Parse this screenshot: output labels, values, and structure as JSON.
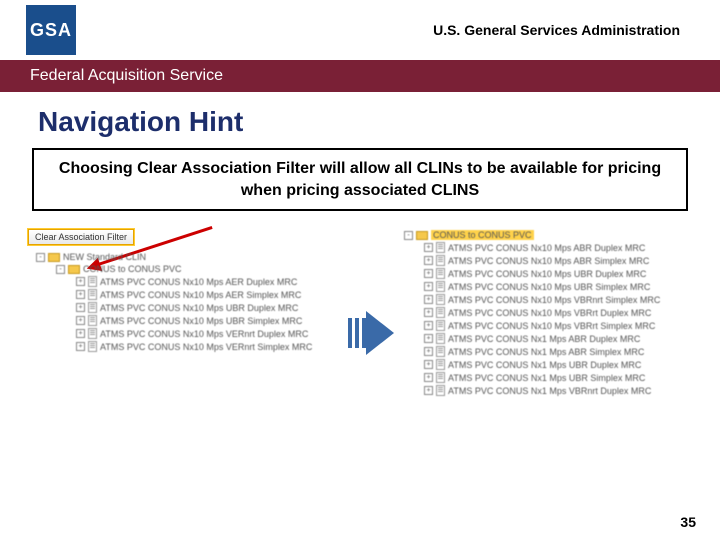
{
  "header": {
    "logo_text": "GSA",
    "org_title": "U.S. General Services Administration",
    "bar_text": "Federal Acquisition Service"
  },
  "title": "Navigation Hint",
  "callout": "Choosing Clear Association Filter will allow all CLINs to be available for pricing when pricing associated CLINS",
  "left": {
    "clear_btn": "Clear Association Filter",
    "root_folder": "NEW Standard CLIN",
    "sub_folder": "CONUS to CONUS PVC",
    "items": [
      "ATMS PVC CONUS Nx10 Mps AER Duplex MRC",
      "ATMS PVC CONUS Nx10 Mps AER Simplex MRC",
      "ATMS PVC CONUS Nx10 Mps UBR Duplex MRC",
      "ATMS PVC CONUS Nx10 Mps UBR Simplex MRC",
      "ATMS PVC CONUS Nx10 Mps VERnrt Duplex MRC",
      "ATMS PVC CONUS Nx10 Mps VERnrt Simplex MRC"
    ]
  },
  "right": {
    "folder": "CONUS to CONUS PVC",
    "items": [
      "ATMS PVC CONUS Nx10 Mps ABR Duplex MRC",
      "ATMS PVC CONUS Nx10 Mps ABR Simplex MRC",
      "ATMS PVC CONUS Nx10 Mps UBR Duplex MRC",
      "ATMS PVC CONUS Nx10 Mps UBR Simplex MRC",
      "ATMS PVC CONUS Nx10 Mps VBRnrt Simplex MRC",
      "ATMS PVC CONUS Nx10 Mps VBRrt Duplex MRC",
      "ATMS PVC CONUS Nx10 Mps VBRrt Simplex MRC",
      "ATMS PVC CONUS Nx1 Mps ABR Duplex MRC",
      "ATMS PVC CONUS Nx1 Mps ABR Simplex MRC",
      "ATMS PVC CONUS Nx1 Mps UBR Duplex MRC",
      "ATMS PVC CONUS Nx1 Mps UBR Simplex MRC",
      "ATMS PVC CONUS Nx1 Mps VBRnrt Duplex MRC"
    ]
  },
  "page_number": "35"
}
